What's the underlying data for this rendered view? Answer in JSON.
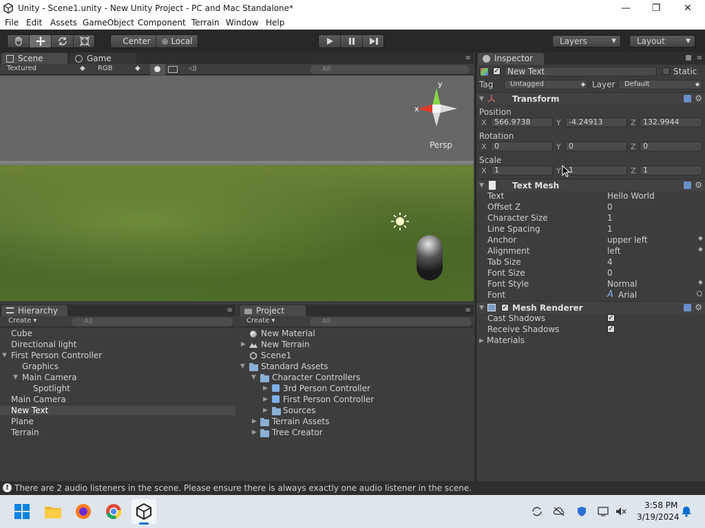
{
  "window": {
    "title": "Unity - Scene1.unity - New Unity Project - PC and Mac Standalone*",
    "minimize": "—",
    "maximize": "❐",
    "close": "✕"
  },
  "menu": [
    "File",
    "Edit",
    "Assets",
    "GameObject",
    "Component",
    "Terrain",
    "Window",
    "Help"
  ],
  "toolbar": {
    "pivot": "Center",
    "space": "Local",
    "layers": "Layers",
    "layout": "Layout"
  },
  "scene": {
    "tab": "Scene",
    "game_tab": "Game",
    "render_mode": "Textured",
    "color_mode": "RGB",
    "search_placeholder": "All",
    "gizmo_label": "Persp",
    "axis_y": "y",
    "axis_x": "x"
  },
  "hierarchy": {
    "tab": "Hierarchy",
    "create": "Create",
    "search_placeholder": "All",
    "items": [
      {
        "label": "Cube",
        "indent": 0,
        "expanded": null
      },
      {
        "label": "Directional light",
        "indent": 0,
        "expanded": null
      },
      {
        "label": "First Person Controller",
        "indent": 0,
        "expanded": true
      },
      {
        "label": "Graphics",
        "indent": 1,
        "expanded": null
      },
      {
        "label": "Main Camera",
        "indent": 1,
        "expanded": true
      },
      {
        "label": "Spotlight",
        "indent": 2,
        "expanded": null
      },
      {
        "label": "Main Camera",
        "indent": 0,
        "expanded": null
      },
      {
        "label": "New Text",
        "indent": 0,
        "expanded": null,
        "selected": true
      },
      {
        "label": "Plane",
        "indent": 0,
        "expanded": null
      },
      {
        "label": "Terrain",
        "indent": 0,
        "expanded": null
      }
    ]
  },
  "project": {
    "tab": "Project",
    "create": "Create",
    "search_placeholder": "All",
    "items": [
      {
        "label": "New Material",
        "indent": 0,
        "icon": "material-icon"
      },
      {
        "label": "New Terrain",
        "indent": 0,
        "icon": "terrain-icon",
        "collapsed": true
      },
      {
        "label": "Scene1",
        "indent": 0,
        "icon": "unity-scene-icon"
      },
      {
        "label": "Standard Assets",
        "indent": 0,
        "icon": "folder-icon",
        "expanded": true
      },
      {
        "label": "Character Controllers",
        "indent": 1,
        "icon": "folder-icon",
        "expanded": true
      },
      {
        "label": "3rd Person Controller",
        "indent": 2,
        "icon": "prefab-icon",
        "collapsed": true
      },
      {
        "label": "First Person Controller",
        "indent": 2,
        "icon": "prefab-icon",
        "collapsed": true
      },
      {
        "label": "Sources",
        "indent": 2,
        "icon": "folder-icon",
        "collapsed": true
      },
      {
        "label": "Terrain Assets",
        "indent": 1,
        "icon": "folder-icon",
        "collapsed": true
      },
      {
        "label": "Tree Creator",
        "indent": 1,
        "icon": "folder-icon",
        "collapsed": true
      }
    ]
  },
  "inspector": {
    "tab": "Inspector",
    "object_name": "New Text",
    "static_label": "Static",
    "tag_label": "Tag",
    "tag_value": "Untagged",
    "layer_label": "Layer",
    "layer_value": "Default",
    "transform": {
      "title": "Transform",
      "position_label": "Position",
      "rotation_label": "Rotation",
      "scale_label": "Scale",
      "position": {
        "x": "566.9738",
        "y": "-4.24913",
        "z": "132.9944"
      },
      "rotation": {
        "x": "0",
        "y": "0",
        "z": "0"
      },
      "scale": {
        "x": "1",
        "y": "1",
        "z": "1"
      },
      "axis_x": "X",
      "axis_y": "Y",
      "axis_z": "Z"
    },
    "text_mesh": {
      "title": "Text Mesh",
      "props": [
        {
          "label": "Text",
          "value": "Hello World"
        },
        {
          "label": "Offset Z",
          "value": "0"
        },
        {
          "label": "Character Size",
          "value": "1"
        },
        {
          "label": "Line Spacing",
          "value": "1"
        },
        {
          "label": "Anchor",
          "value": "upper left"
        },
        {
          "label": "Alignment",
          "value": "left"
        },
        {
          "label": "Tab Size",
          "value": "4"
        },
        {
          "label": "Font Size",
          "value": "0"
        },
        {
          "label": "Font Style",
          "value": "Normal"
        },
        {
          "label": "Font",
          "value": "Arial"
        }
      ]
    },
    "mesh_renderer": {
      "title": "Mesh Renderer",
      "cast_shadows_label": "Cast Shadows",
      "receive_shadows_label": "Receive Shadows",
      "materials_label": "Materials",
      "check": "✓"
    }
  },
  "status": {
    "message": "There are 2 audio listeners in the scene. Please ensure there is always exactly one audio listener in the scene."
  },
  "taskbar": {
    "time": "3:58 PM",
    "date": "3/19/2024"
  },
  "colors": {
    "unity_dark": "#3d3d3d",
    "taskbar": "#dfe5ec",
    "grass": "#5f7a31",
    "sky": "#676767"
  }
}
